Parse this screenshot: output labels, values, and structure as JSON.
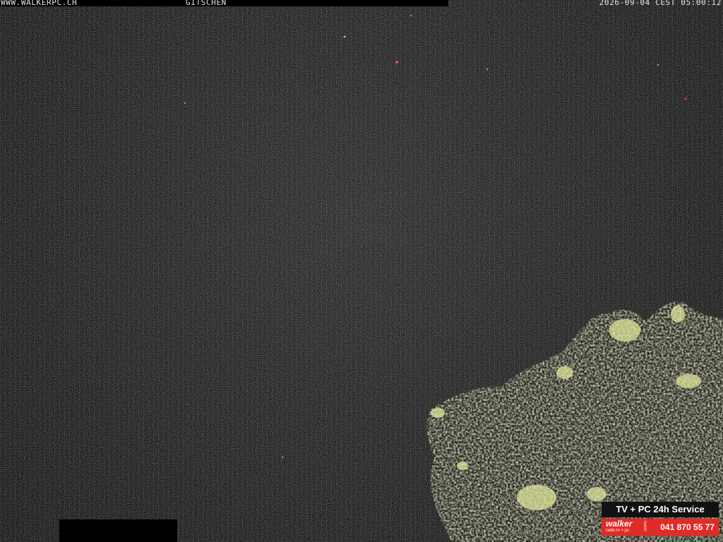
{
  "overlay": {
    "site": "WWW.WALKERPC.CH",
    "location": "GITSCHEN",
    "timestamp": "2026-09-04 CEST 05:00:12"
  },
  "ad": {
    "headline": "TV + PC 24h Service",
    "brand": "walker",
    "brand_sub": "radio tv + pc",
    "brand_suffix": "GmbH",
    "phone": "041 870 55 77",
    "colors": {
      "red": "#e12b26",
      "dark": "#111111",
      "text": "#ffffff"
    }
  },
  "scene": {
    "description_colors": {
      "sky": "#151515",
      "foliage": "#8f8f6a",
      "foliage_highlight": "#d9e39a"
    }
  }
}
